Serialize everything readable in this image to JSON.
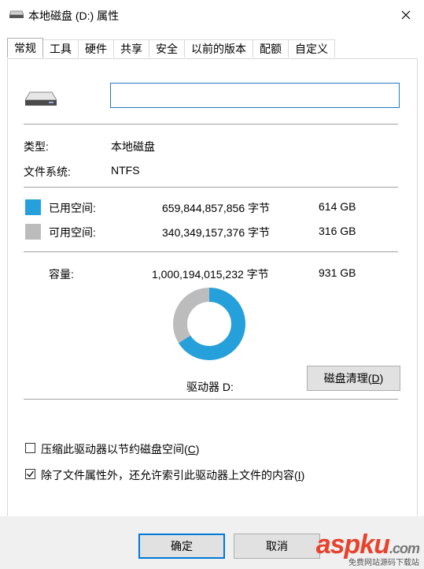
{
  "window": {
    "title": "本地磁盘 (D:) 属性"
  },
  "tabs": [
    "常规",
    "工具",
    "硬件",
    "共享",
    "安全",
    "以前的版本",
    "配额",
    "自定义"
  ],
  "general": {
    "name_value": "",
    "type_label": "类型:",
    "type_value": "本地磁盘",
    "fs_label": "文件系统:",
    "fs_value": "NTFS",
    "used_label": "已用空间:",
    "used_bytes": "659,844,857,856 字节",
    "used_gb": "614 GB",
    "free_label": "可用空间:",
    "free_bytes": "340,349,157,376 字节",
    "free_gb": "316 GB",
    "capacity_label": "容量:",
    "capacity_bytes": "1,000,194,015,232 字节",
    "capacity_gb": "931 GB",
    "drive_label": "驱动器 D:",
    "cleanup_label": "磁盘清理(",
    "cleanup_key": "D",
    "compress_label": "压缩此驱动器以节约磁盘空间(",
    "compress_key": "C",
    "index_label": "除了文件属性外，还允许索引此驱动器上文件的内容(",
    "index_key": "I",
    "used_color": "#26a0da",
    "free_color": "#bcbcbc",
    "used_fraction": 0.66
  },
  "footer": {
    "ok_label": "确定",
    "cancel_label": "取消"
  },
  "watermark": {
    "brand": "aspku",
    "suffix": ".com",
    "tagline": "免费网站源码下载站"
  },
  "icons": [
    "drive-icon",
    "close-icon",
    "checkbox-checked-icon"
  ]
}
